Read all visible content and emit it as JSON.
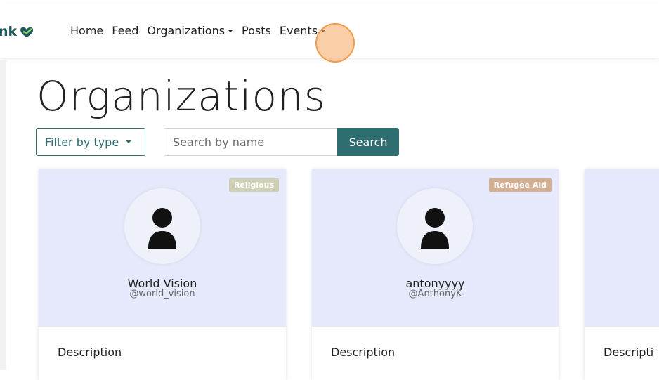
{
  "brand": {
    "logo_text": "nk"
  },
  "nav": {
    "items": [
      {
        "label": "Home",
        "dropdown": false
      },
      {
        "label": "Feed",
        "dropdown": false
      },
      {
        "label": "Organizations",
        "dropdown": true
      },
      {
        "label": "Posts",
        "dropdown": false
      },
      {
        "label": "Events",
        "dropdown": true
      }
    ]
  },
  "page": {
    "title": "Organizations",
    "filter_label": "Filter by type",
    "search_placeholder": "Search by name",
    "search_button": "Search"
  },
  "cards": [
    {
      "badge": "Religious",
      "badge_color": "#cfd0b6",
      "name": "World Vision",
      "handle": "@world_vision",
      "description_label": "Description"
    },
    {
      "badge": "Refugee Aid",
      "badge_color": "#d4b093",
      "name": "antonyyyy",
      "handle": "@AnthonyK",
      "description_label": "Description"
    },
    {
      "description_label": "Descripti"
    }
  ],
  "colors": {
    "accent": "#2e6e70",
    "card_header": "#e6e9fb",
    "click_marker": "#f29a47"
  }
}
